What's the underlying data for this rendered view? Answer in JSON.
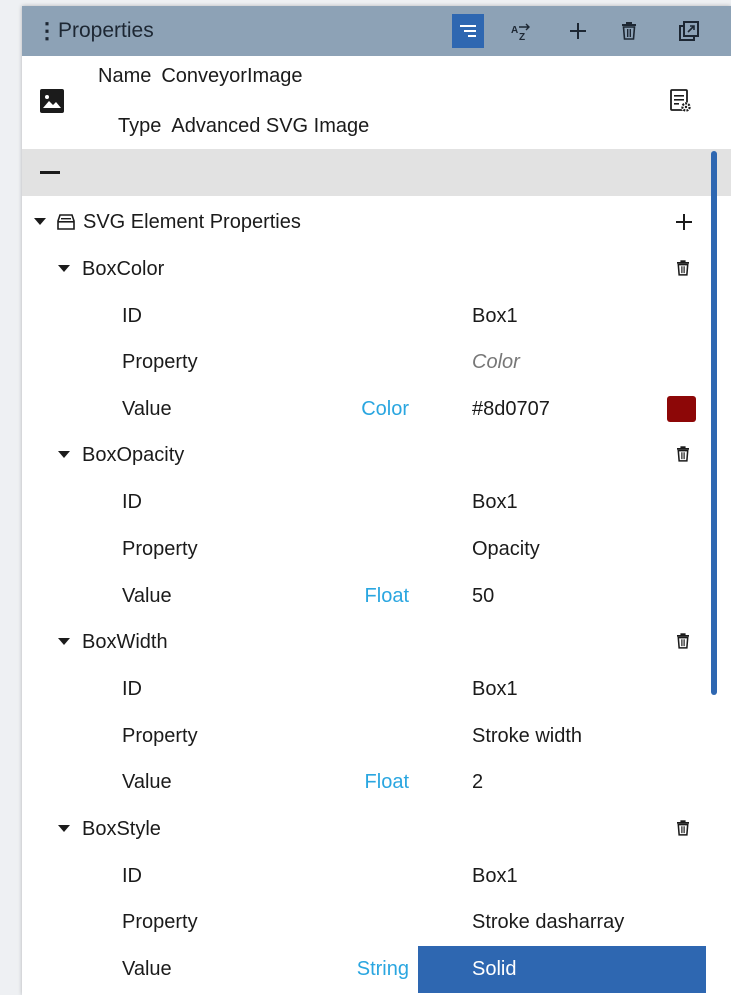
{
  "panel": {
    "title": "Properties"
  },
  "header": {
    "name_label": "Name",
    "name_value": "ConveyorImage",
    "type_label": "Type",
    "type_value": "Advanced SVG Image"
  },
  "group": {
    "label": "SVG Element Properties"
  },
  "items": [
    {
      "name": "BoxColor",
      "rows": [
        {
          "label": "ID",
          "type": "",
          "value": "Box1"
        },
        {
          "label": "Property",
          "type": "",
          "value": "Color"
        },
        {
          "label": "Value",
          "type": "Color",
          "value": "#8d0707"
        }
      ],
      "swatch": "#8d0707"
    },
    {
      "name": "BoxOpacity",
      "rows": [
        {
          "label": "ID",
          "type": "",
          "value": "Box1"
        },
        {
          "label": "Property",
          "type": "",
          "value": "Opacity"
        },
        {
          "label": "Value",
          "type": "Float",
          "value": "50"
        }
      ]
    },
    {
      "name": "BoxWidth",
      "rows": [
        {
          "label": "ID",
          "type": "",
          "value": "Box1"
        },
        {
          "label": "Property",
          "type": "",
          "value": "Stroke width"
        },
        {
          "label": "Value",
          "type": "Float",
          "value": "2"
        }
      ]
    },
    {
      "name": "BoxStyle",
      "rows": [
        {
          "label": "ID",
          "type": "",
          "value": "Box1"
        },
        {
          "label": "Property",
          "type": "",
          "value": "Stroke dasharray"
        },
        {
          "label": "Value",
          "type": "String",
          "value": "Solid"
        }
      ]
    }
  ],
  "colors": {
    "accent": "#2e67b1",
    "titlebar": "#8da2b6",
    "type_text": "#2aa6e0",
    "swatch": "#8d0707"
  }
}
